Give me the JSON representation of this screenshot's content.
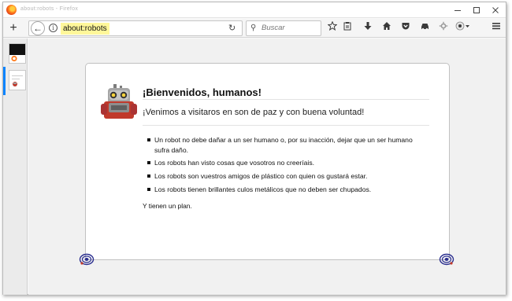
{
  "window": {
    "title": "about:robots - Firefox"
  },
  "toolbar": {
    "new_tab_symbol": "+",
    "back_symbol": "←",
    "info_symbol": "i",
    "url": "about:robots",
    "reload_symbol": "↻",
    "search_placeholder": "Buscar",
    "search_symbol": "⚲"
  },
  "page": {
    "heading": "¡Bienvenidos, humanos!",
    "subtitle": "¡Venimos a visitaros en son de paz y con buena voluntad!",
    "laws": [
      "Un robot no debe dañar a un ser humano o, por su inacción, dejar que un ser humano sufra daño.",
      "Los robots han visto cosas que vosotros no creeríais.",
      "Los robots son vuestros amigos de plástico con quien os gustará estar.",
      "Los robots tienen brillantes culos metálicos que no deben ser chupados."
    ],
    "closing": "Y tienen un plan."
  },
  "colors": {
    "accent": "#0a84ff",
    "url_highlight": "#fff79a",
    "bolt": "#2b2f8f"
  }
}
